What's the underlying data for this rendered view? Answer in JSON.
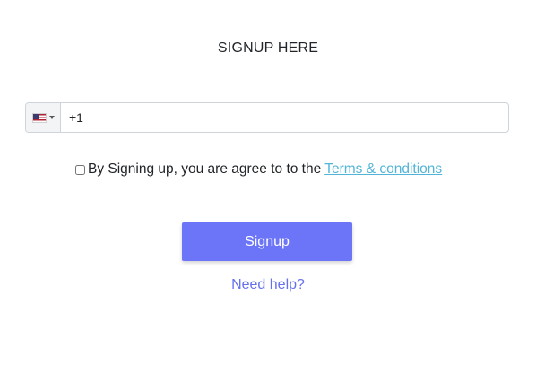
{
  "form": {
    "title": "SIGNUP HERE",
    "phone": {
      "country_flag": "us-flag-icon",
      "value": "+1"
    },
    "terms": {
      "label": "By Signing up, you are agree to to the",
      "link_text": "Terms & conditions",
      "checked": false
    },
    "submit_label": "Signup",
    "help_link": "Need help?"
  },
  "colors": {
    "button": "#6c75f7",
    "terms_link": "#52b4d6",
    "help_link": "#6470ee"
  }
}
